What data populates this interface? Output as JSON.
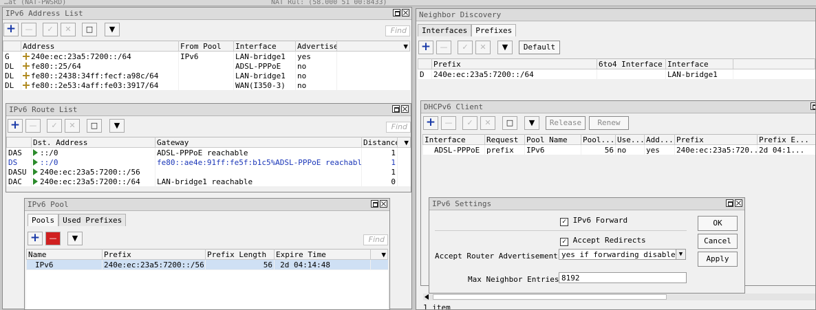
{
  "background_titles": {
    "left": "…at (NAT-PWSRD)",
    "middle": "NAT Rul: (58.000 51 00:8433)"
  },
  "find_placeholder": "Find",
  "addr_list": {
    "title": "IPv6 Address List",
    "columns": [
      "",
      "Address",
      "From Pool",
      "Interface",
      "Advertise"
    ],
    "rows": [
      {
        "flag": "G",
        "address": "240e:ec:23a5:7200::/64",
        "pool": "IPv6",
        "iface": "LAN-bridge1",
        "adv": "yes"
      },
      {
        "flag": "DL",
        "address": "fe80::25/64",
        "pool": "",
        "iface": "ADSL-PPPoE",
        "adv": "no"
      },
      {
        "flag": "DL",
        "address": "fe80::2438:34ff:fecf:a98c/64",
        "pool": "",
        "iface": "LAN-bridge1",
        "adv": "no"
      },
      {
        "flag": "DL",
        "address": "fe80::2e53:4aff:fe03:3917/64",
        "pool": "",
        "iface": "WAN(I350-3)",
        "adv": "no"
      }
    ]
  },
  "route_list": {
    "title": "IPv6 Route List",
    "columns": [
      "",
      "Dst. Address",
      "Gateway",
      "Distance"
    ],
    "rows": [
      {
        "flag": "DAS",
        "dst": "::/0",
        "gw": "ADSL-PPPoE reachable",
        "dist": "1"
      },
      {
        "flag": "DS",
        "dst": "::/0",
        "gw": "fe80::ae4e:91ff:fe5f:b1c5%ADSL-PPPoE reachable",
        "dist": "1"
      },
      {
        "flag": "DASU",
        "dst": "240e:ec:23a5:7200::/56",
        "gw": "",
        "dist": "1"
      },
      {
        "flag": "DAC",
        "dst": "240e:ec:23a5:7200::/64",
        "gw": "LAN-bridge1 reachable",
        "dist": "0"
      }
    ]
  },
  "pool": {
    "title": "IPv6 Pool",
    "tabs": [
      "Pools",
      "Used Prefixes"
    ],
    "columns": [
      "Name",
      "Prefix",
      "Prefix Length",
      "Expire Time"
    ],
    "rows": [
      {
        "name": "IPv6",
        "prefix": "240e:ec:23a5:7200::/56",
        "len": "56",
        "expire": "2d 04:14:48"
      }
    ]
  },
  "nd": {
    "title": "Neighbor Discovery",
    "tabs": [
      "Interfaces",
      "Prefixes"
    ],
    "default_btn": "Default",
    "columns": [
      "",
      "Prefix",
      "6to4 Interface",
      "Interface"
    ],
    "rows": [
      {
        "flag": "D",
        "prefix": "240e:ec:23a5:7200::/64",
        "to4": "",
        "iface": "LAN-bridge1"
      }
    ],
    "status": "1 item"
  },
  "dhcp": {
    "title": "DHCPv6 Client",
    "release_btn": "Release",
    "renew_btn": "Renew",
    "columns": [
      "Interface",
      "Request",
      "Pool Name",
      "Pool...",
      "Use...",
      "Add...",
      "Prefix",
      "Prefix E..."
    ],
    "rows": [
      {
        "iface": "ADSL-PPPoE",
        "req": "prefix",
        "pool": "IPv6",
        "plen": "56",
        "use": "no",
        "add": "yes",
        "prefix": "240e:ec:23a5:720...",
        "exp": "2d 04:1..."
      }
    ]
  },
  "settings": {
    "title": "IPv6 Settings",
    "ipv6_forward": "IPv6 Forward",
    "accept_redirects": "Accept Redirects",
    "ara_label": "Accept Router Advertisements:",
    "ara_value": "yes if forwarding disabled",
    "mne_label": "Max Neighbor Entries:",
    "mne_value": "8192",
    "ok": "OK",
    "cancel": "Cancel",
    "apply": "Apply"
  }
}
